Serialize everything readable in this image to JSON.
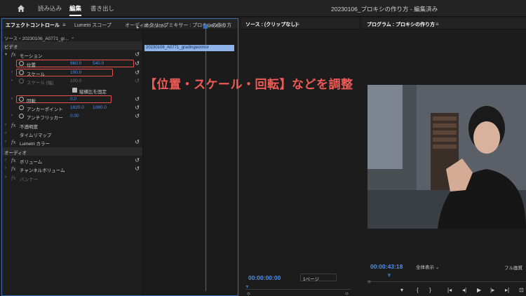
{
  "topbar": {
    "tabs": [
      {
        "label": "読み込み",
        "active": false
      },
      {
        "label": "編集",
        "active": true
      },
      {
        "label": "書き出し",
        "active": false
      }
    ],
    "document_title": "20230106_プロキシの作り方 - 編集済み"
  },
  "effect_panel": {
    "tabs": [
      "エフェクトコントロール",
      "Lumetri スコープ",
      "オーディオクリップミキサー : プロキシの作り方"
    ],
    "source_label": "ソース・20230106_A0771_gr...",
    "section_video": "ビデオ",
    "section_audio": "オーディオ",
    "motion": "モーション",
    "position": {
      "label": "位置",
      "x": "960.0",
      "y": "540.0"
    },
    "scale": {
      "label": "スケール",
      "value": "100.0"
    },
    "scale_width": {
      "label": "スケール (幅)",
      "value": "100.0"
    },
    "uniform_scale": "縦横比を固定",
    "rotation": {
      "label": "回転",
      "value": "0.0"
    },
    "anchor": {
      "label": "アンカーポイント",
      "x": "1920.0",
      "y": "1080.0"
    },
    "antiflicker": {
      "label": "アンチフリッカー",
      "value": "0.00"
    },
    "opacity": "不透明度",
    "time_remap": "タイムリマップ",
    "lumetri": "Lumetri カラー",
    "volume": "ボリューム",
    "channel_volume": "チャンネルボリューム",
    "panner": "パンナー",
    "timeline_start": "00;00;30;00",
    "timeline_end": "00;00;45;00",
    "clip_name": "20230106_A0771_gradingeormor"
  },
  "source_panel": {
    "title": "ソース : (クリップなし)",
    "timecode": "00:00:00:00",
    "page_dropdown": "1ページ"
  },
  "program_panel": {
    "title": "プログラム : プロキシの作り方",
    "timecode": "00:00:43:18",
    "fit_dropdown": "全体表示",
    "quality": "フル画質"
  },
  "caption": "【位置・スケール・回転】などを調整",
  "colors": {
    "accent": "#3a6db4",
    "value_blue": "#4f8fe6",
    "highlight": "#e8524f",
    "caption": "#f05a55"
  }
}
